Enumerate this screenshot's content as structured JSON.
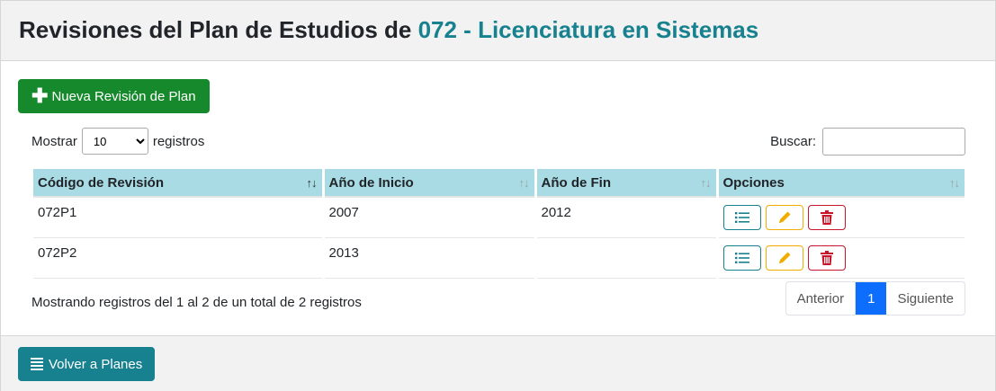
{
  "header": {
    "title_prefix": "Revisiones del Plan de Estudios de ",
    "title_accent": "072 - Licenciatura en Sistemas"
  },
  "actions": {
    "new_revision_label": "Nueva Revisión de Plan"
  },
  "length": {
    "prefix": "Mostrar",
    "value": "10",
    "suffix": "registros"
  },
  "search": {
    "label": "Buscar:",
    "value": ""
  },
  "table": {
    "columns": [
      "Código de Revisión",
      "Año de Inicio",
      "Año de Fin",
      "Opciones"
    ],
    "rows": [
      {
        "code": "072P1",
        "start": "2007",
        "end": "2012"
      },
      {
        "code": "072P2",
        "start": "2013",
        "end": ""
      }
    ]
  },
  "info": "Mostrando registros del 1 al 2 de un total de 2 registros",
  "pagination": {
    "previous": "Anterior",
    "current": "1",
    "next": "Siguiente"
  },
  "footer": {
    "back_label": "Volver a Planes"
  },
  "colors": {
    "accent": "#17818f",
    "success": "#15892b",
    "warning": "#f0ad00",
    "danger": "#c8152b",
    "primary": "#0d6efd",
    "table_header": "#a8dbe3"
  }
}
